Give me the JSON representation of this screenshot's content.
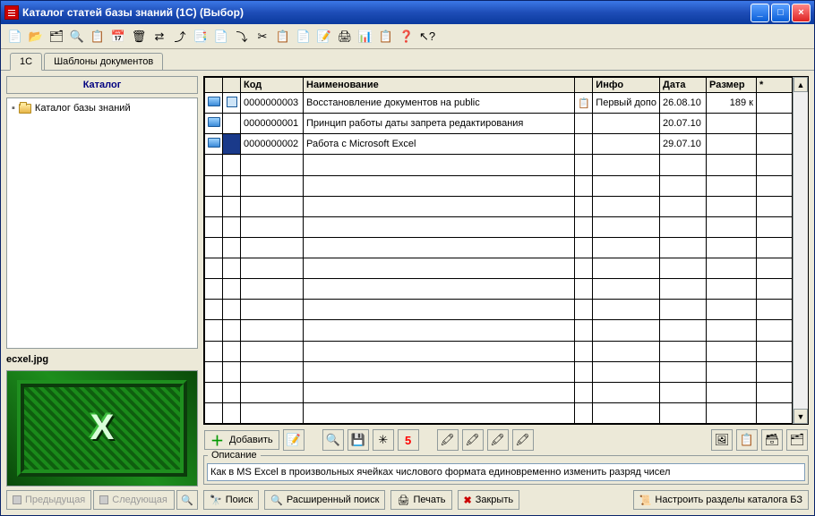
{
  "window": {
    "title": "Каталог статей базы знаний (1С) (Выбор)"
  },
  "tabs": {
    "tab1": "1С",
    "tab2": "Шаблоны документов"
  },
  "sidebar": {
    "header": "Каталог",
    "root": "Каталог базы знаний",
    "file_label": "ecxel.jpg",
    "prev": "Предыдущая",
    "next": "Следующая"
  },
  "grid": {
    "headers": {
      "code": "Код",
      "name": "Наименование",
      "info": "Инфо",
      "date": "Дата",
      "size": "Размер",
      "star": "*"
    },
    "rows": [
      {
        "code": "0000000003",
        "name": "Восстановление документов на public",
        "info": "Первый допо",
        "date": "26.08.10",
        "size": "189 к"
      },
      {
        "code": "0000000001",
        "name": "Принцип работы даты запрета редактирования",
        "info": "",
        "date": "20.07.10",
        "size": ""
      },
      {
        "code": "0000000002",
        "name": "Работа с Microsoft Excel",
        "info": "",
        "date": "29.07.10",
        "size": ""
      }
    ]
  },
  "mid": {
    "add": "Добавить"
  },
  "desc": {
    "label": "Описание",
    "text": "Как в MS Excel в произвольных ячейках числового формата единовременно изменить разряд чисел"
  },
  "bottom": {
    "search": "Поиск",
    "advanced": "Расширенный поиск",
    "print": "Печать",
    "close": "Закрыть",
    "configure": "Настроить разделы каталога БЗ"
  }
}
